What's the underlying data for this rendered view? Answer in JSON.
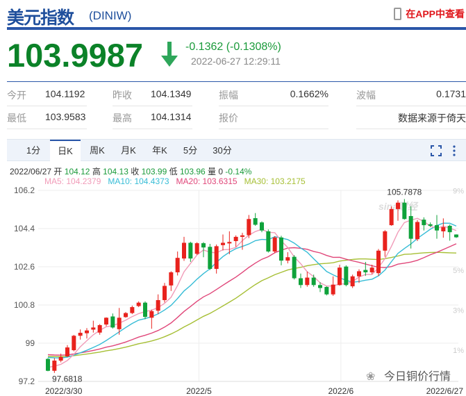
{
  "header": {
    "title": "美元指数",
    "code": "(DINIW)",
    "app_link": "在APP中查看"
  },
  "quote": {
    "price": "103.9987",
    "change": "-0.1362 (-0.1308%)",
    "timestamp": "2022-06-27 12:29:11",
    "direction": "down"
  },
  "stats": [
    {
      "label": "今开",
      "value": "104.1192"
    },
    {
      "label": "昨收",
      "value": "104.1349"
    },
    {
      "label": "振幅",
      "value": "0.1662%"
    },
    {
      "label": "波幅",
      "value": "0.1731"
    },
    {
      "label": "最低",
      "value": "103.9583"
    },
    {
      "label": "最高",
      "value": "104.1314"
    },
    {
      "label": "报价",
      "value": ""
    },
    {
      "label": "",
      "value": "数据来源于倚天"
    }
  ],
  "tabs": [
    "1分",
    "日K",
    "周K",
    "月K",
    "年K",
    "5分",
    "30分"
  ],
  "active_tab": "日K",
  "info": {
    "date": "2022/06/27",
    "open_l": "开",
    "open": "104.12",
    "high_l": "高",
    "high": "104.13",
    "close_l": "收",
    "close": "103.99",
    "low_l": "低",
    "low": "103.96",
    "vol_l": "量",
    "vol": "0",
    "pct": "-0.14%"
  },
  "ma_legend": {
    "ma5": "MA5: 104.2379",
    "ma10": "MA10: 104.4373",
    "ma20": "MA20: 103.6315",
    "ma30": "MA30: 103.2175"
  },
  "watermark": {
    "sina": "sina财经",
    "wechat": "今日铜价行情"
  },
  "colors": {
    "up": "#e8221d",
    "down": "#0fa23b",
    "ma5": "#f19bb8",
    "ma10": "#36bcd6",
    "ma20": "#e04679",
    "ma30": "#a6bf34"
  },
  "chart_data": {
    "type": "candlestick",
    "ylim": [
      97.2,
      106.2
    ],
    "yticks": [
      "106.2",
      "104.4",
      "102.6",
      "100.8",
      "99",
      "97.2"
    ],
    "pct_ticks": [
      "9%",
      "5%",
      "3%",
      "1%"
    ],
    "xlabels": [
      {
        "label": "2022/3/30",
        "index": 0
      },
      {
        "label": "2022/5",
        "index": 23.3
      },
      {
        "label": "2022/6",
        "index": 45.2
      },
      {
        "label": "2022/6/27",
        "index": 63
      }
    ],
    "max_label": "105.7878",
    "min_label": "97.6818",
    "ohlc": [
      [
        98.26,
        97.7,
        98.3,
        97.68
      ],
      [
        97.7,
        98.18,
        98.3,
        97.6
      ],
      [
        98.18,
        98.35,
        98.51,
        98.1
      ],
      [
        98.38,
        98.8,
        98.91,
        98.35
      ],
      [
        98.67,
        99.35,
        99.39,
        98.62
      ],
      [
        99.35,
        99.49,
        99.65,
        99.17
      ],
      [
        99.47,
        99.6,
        99.71,
        99.22
      ],
      [
        99.64,
        99.74,
        100.06,
        99.5
      ],
      [
        99.5,
        99.85,
        99.9,
        99.4
      ],
      [
        99.88,
        100.2,
        100.22,
        99.8
      ],
      [
        100.26,
        99.74,
        100.4,
        99.69
      ],
      [
        99.66,
        100.2,
        100.66,
        99.4
      ],
      [
        100.23,
        100.42,
        100.47,
        100.2
      ],
      [
        100.42,
        100.7,
        100.77,
        100.37
      ],
      [
        100.75,
        100.91,
        100.97,
        100.7
      ],
      [
        100.91,
        100.24,
        100.97,
        100.13
      ],
      [
        100.2,
        100.51,
        100.58,
        99.68
      ],
      [
        100.53,
        101.03,
        101.3,
        100.37
      ],
      [
        101.03,
        101.7,
        101.84,
        100.92
      ],
      [
        101.72,
        102.34,
        102.39,
        101.46
      ],
      [
        102.34,
        103.02,
        103.32,
        102.19
      ],
      [
        102.99,
        103.73,
        104.01,
        102.88
      ],
      [
        103.73,
        102.99,
        103.78,
        102.83
      ],
      [
        103.21,
        103.71,
        103.76,
        103.16
      ],
      [
        103.71,
        103.51,
        103.76,
        103.05
      ],
      [
        103.54,
        102.5,
        103.68,
        102.45
      ],
      [
        102.5,
        103.57,
        103.65,
        102.28
      ],
      [
        103.62,
        103.73,
        104.12,
        103.37
      ],
      [
        103.7,
        103.77,
        104.27,
        103.19
      ],
      [
        103.81,
        104.01,
        104.08,
        103.54
      ],
      [
        104.01,
        104.08,
        104.2,
        103.4
      ],
      [
        104.09,
        104.85,
        105.04,
        103.95
      ],
      [
        104.89,
        104.58,
        105.13,
        104.53
      ],
      [
        104.69,
        104.31,
        104.74,
        104.23
      ],
      [
        104.27,
        103.32,
        104.36,
        103.27
      ],
      [
        103.32,
        103.98,
        104.04,
        103.24
      ],
      [
        103.98,
        102.89,
        104.06,
        102.67
      ],
      [
        102.89,
        103.05,
        103.29,
        102.76
      ],
      [
        103.07,
        102.06,
        103.15,
        102.0
      ],
      [
        102.06,
        101.74,
        102.28,
        101.6
      ],
      [
        101.74,
        102.09,
        102.37,
        101.66
      ],
      [
        102.09,
        101.74,
        102.23,
        101.66
      ],
      [
        101.74,
        101.6,
        101.87,
        101.41
      ],
      [
        101.65,
        101.3,
        101.68,
        101.25
      ],
      [
        101.3,
        101.76,
        102.15,
        101.23
      ],
      [
        101.74,
        102.56,
        102.7,
        101.71
      ],
      [
        102.61,
        101.74,
        102.67,
        101.68
      ],
      [
        101.68,
        102.15,
        102.23,
        101.6
      ],
      [
        102.15,
        102.39,
        102.48,
        101.84
      ],
      [
        102.45,
        102.34,
        102.83,
        102.17
      ],
      [
        102.34,
        102.56,
        102.7,
        102.26
      ],
      [
        102.3,
        103.36,
        103.44,
        102.17
      ],
      [
        103.36,
        104.27,
        104.33,
        103.07
      ],
      [
        104.56,
        105.32,
        105.44,
        104.53
      ],
      [
        105.32,
        105.62,
        105.73,
        104.77
      ],
      [
        105.62,
        104.85,
        105.79,
        104.82
      ],
      [
        104.99,
        103.92,
        105.45,
        103.46
      ],
      [
        103.9,
        104.71,
        104.8,
        103.81
      ],
      [
        104.82,
        104.56,
        104.93,
        104.31
      ],
      [
        104.6,
        104.53,
        104.69,
        104.47
      ],
      [
        104.56,
        104.31,
        105.04,
        103.92
      ],
      [
        104.27,
        104.47,
        104.88,
        103.97
      ],
      [
        104.53,
        104.23,
        104.59,
        103.83
      ],
      [
        104.12,
        103.99,
        104.13,
        103.96
      ]
    ]
  }
}
